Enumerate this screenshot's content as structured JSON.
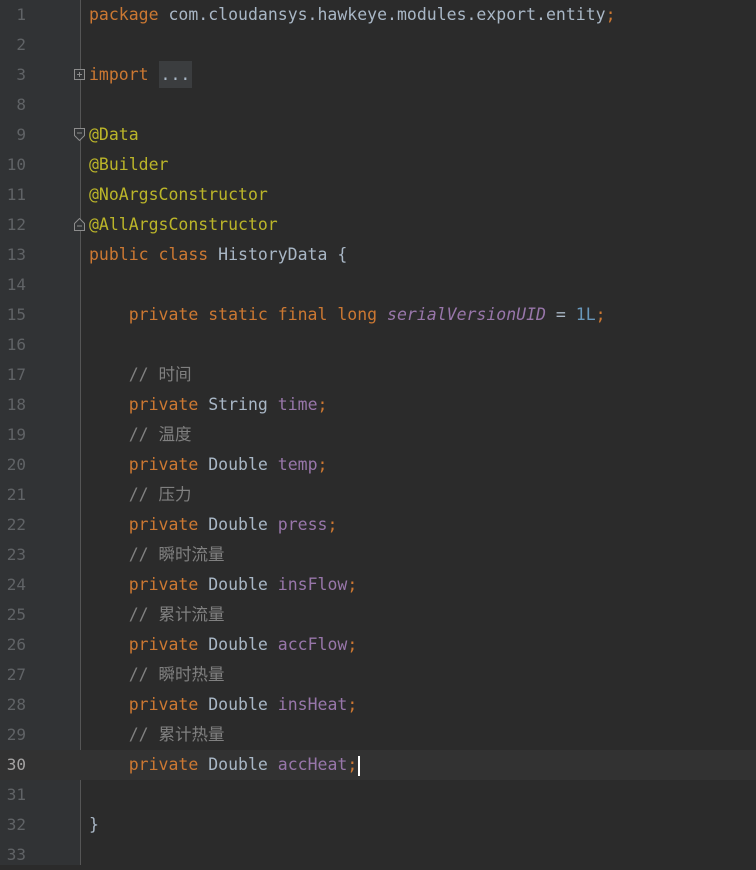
{
  "editor": {
    "current_line": 30,
    "lines": [
      {
        "num": "1",
        "tokens": [
          [
            "kw",
            "package "
          ],
          [
            "id",
            "com.cloudansys.hawkeye.modules.export.entity"
          ],
          [
            "kw",
            ";"
          ]
        ]
      },
      {
        "num": "2",
        "tokens": []
      },
      {
        "num": "3",
        "fold": "plus",
        "tokens": [
          [
            "kw",
            "import "
          ],
          [
            "collapsed",
            "..."
          ]
        ]
      },
      {
        "num": "8",
        "tokens": []
      },
      {
        "num": "9",
        "fold": "open",
        "tokens": [
          [
            "ann",
            "@Data"
          ]
        ]
      },
      {
        "num": "10",
        "tokens": [
          [
            "ann",
            "@Builder"
          ]
        ]
      },
      {
        "num": "11",
        "tokens": [
          [
            "ann",
            "@NoArgsConstructor"
          ]
        ]
      },
      {
        "num": "12",
        "fold": "close",
        "tokens": [
          [
            "ann",
            "@AllArgsConstructor"
          ]
        ]
      },
      {
        "num": "13",
        "tokens": [
          [
            "kw",
            "public class "
          ],
          [
            "id",
            "HistoryData {"
          ]
        ]
      },
      {
        "num": "14",
        "tokens": []
      },
      {
        "num": "15",
        "tokens": [
          [
            "id",
            "    "
          ],
          [
            "kw",
            "private static final long "
          ],
          [
            "const",
            "serialVersionUID"
          ],
          [
            "id",
            " = "
          ],
          [
            "num",
            "1L"
          ],
          [
            "kw",
            ";"
          ]
        ]
      },
      {
        "num": "16",
        "tokens": []
      },
      {
        "num": "17",
        "tokens": [
          [
            "com",
            "    // 时间"
          ]
        ]
      },
      {
        "num": "18",
        "tokens": [
          [
            "id",
            "    "
          ],
          [
            "kw",
            "private "
          ],
          [
            "id",
            "String "
          ],
          [
            "field",
            "time"
          ],
          [
            "kw",
            ";"
          ]
        ]
      },
      {
        "num": "19",
        "tokens": [
          [
            "com",
            "    // 温度"
          ]
        ]
      },
      {
        "num": "20",
        "tokens": [
          [
            "id",
            "    "
          ],
          [
            "kw",
            "private "
          ],
          [
            "id",
            "Double "
          ],
          [
            "field",
            "temp"
          ],
          [
            "kw",
            ";"
          ]
        ]
      },
      {
        "num": "21",
        "tokens": [
          [
            "com",
            "    // 压力"
          ]
        ]
      },
      {
        "num": "22",
        "tokens": [
          [
            "id",
            "    "
          ],
          [
            "kw",
            "private "
          ],
          [
            "id",
            "Double "
          ],
          [
            "field",
            "press"
          ],
          [
            "kw",
            ";"
          ]
        ]
      },
      {
        "num": "23",
        "tokens": [
          [
            "com",
            "    // 瞬时流量"
          ]
        ]
      },
      {
        "num": "24",
        "tokens": [
          [
            "id",
            "    "
          ],
          [
            "kw",
            "private "
          ],
          [
            "id",
            "Double "
          ],
          [
            "field",
            "insFlow"
          ],
          [
            "kw",
            ";"
          ]
        ]
      },
      {
        "num": "25",
        "tokens": [
          [
            "com",
            "    // 累计流量"
          ]
        ]
      },
      {
        "num": "26",
        "tokens": [
          [
            "id",
            "    "
          ],
          [
            "kw",
            "private "
          ],
          [
            "id",
            "Double "
          ],
          [
            "field",
            "accFlow"
          ],
          [
            "kw",
            ";"
          ]
        ]
      },
      {
        "num": "27",
        "tokens": [
          [
            "com",
            "    // 瞬时热量"
          ]
        ]
      },
      {
        "num": "28",
        "tokens": [
          [
            "id",
            "    "
          ],
          [
            "kw",
            "private "
          ],
          [
            "id",
            "Double "
          ],
          [
            "field",
            "insHeat"
          ],
          [
            "kw",
            ";"
          ]
        ]
      },
      {
        "num": "29",
        "tokens": [
          [
            "com",
            "    // 累计热量"
          ]
        ]
      },
      {
        "num": "30",
        "tokens": [
          [
            "id",
            "    "
          ],
          [
            "kw",
            "private "
          ],
          [
            "id",
            "Double "
          ],
          [
            "field",
            "accHeat"
          ],
          [
            "kw",
            ";"
          ]
        ]
      },
      {
        "num": "31",
        "tokens": []
      },
      {
        "num": "32",
        "tokens": [
          [
            "id",
            "}"
          ]
        ]
      },
      {
        "num": "33",
        "tokens": []
      }
    ]
  }
}
